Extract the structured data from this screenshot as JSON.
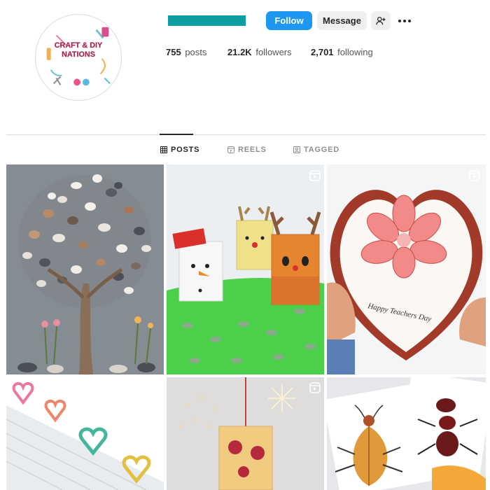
{
  "profile": {
    "logo_text_line1": "CRAFT & DIY",
    "logo_text_line2": "NATIONS"
  },
  "actions": {
    "follow_label": "Follow",
    "message_label": "Message",
    "add_user_icon": "person-add-icon",
    "more_icon": "more-horizontal-icon"
  },
  "stats": {
    "posts_count": "755",
    "posts_label": "posts",
    "followers_count": "21.2K",
    "followers_label": "followers",
    "following_count": "2,701",
    "following_label": "following"
  },
  "tabs": [
    {
      "label": "POSTS",
      "icon": "grid-icon",
      "active": true
    },
    {
      "label": "REELS",
      "icon": "reels-icon",
      "active": false
    },
    {
      "label": "TAGGED",
      "icon": "tagged-icon",
      "active": false
    }
  ],
  "posts": [
    {
      "subject": "pebble tree art",
      "is_reel": false
    },
    {
      "subject": "paper snowman and reindeer boxes",
      "is_reel": true
    },
    {
      "subject": "heart pop-up flower card",
      "text": "Happy Teachers Day",
      "is_reel": true
    },
    {
      "subject": "heart paper clips",
      "is_reel": true
    },
    {
      "subject": "hanging flower lantern",
      "is_reel": true
    },
    {
      "subject": "leaf insect cards",
      "is_reel": true
    }
  ],
  "colors": {
    "follow_button": "#1e97f0",
    "username_redacted": "#0c9ea0",
    "accent_text": "#262626"
  }
}
